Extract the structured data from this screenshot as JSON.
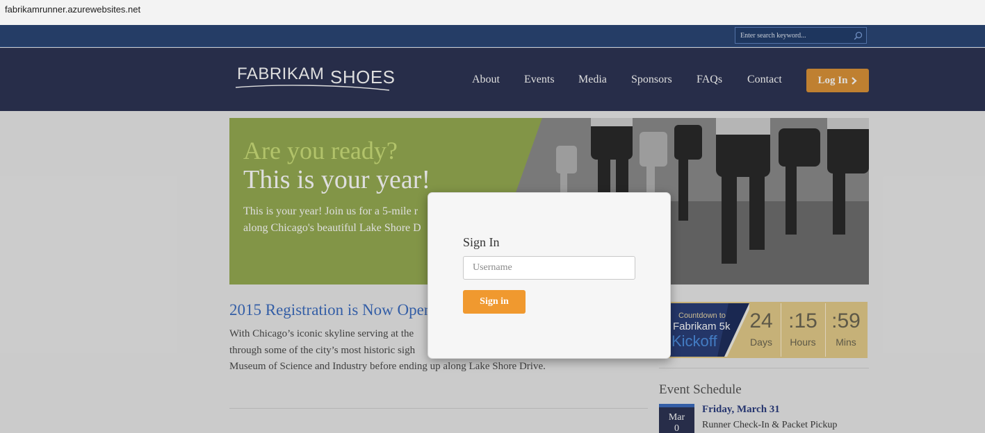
{
  "browser": {
    "url": "fabrikamrunner.azurewebsites.net"
  },
  "topbar": {
    "search_placeholder": "Enter search keyword..."
  },
  "header": {
    "logo_word_1": "FABRIKAM",
    "logo_word_2": "SHOES",
    "nav": [
      "About",
      "Events",
      "Media",
      "Sponsors",
      "FAQs",
      "Contact"
    ],
    "login_label": "Log In"
  },
  "hero": {
    "kicker": "Are you ready?",
    "title": "This is your year!",
    "text_line1": "This is your year! Join us for a 5-mile r",
    "text_line2": "along Chicago's beautiful Lake Shore D"
  },
  "registration": {
    "title": "2015 Registration is Now Open",
    "text_line1": "With Chicago’s iconic skyline serving at the",
    "text_line2": "through some of the city’s most historic sigh",
    "text_line3": "Museum of Science and Industry before ending up along Lake Shore Drive."
  },
  "countdown": {
    "banner_line1": "Countdown to",
    "banner_line2": "Fabrikam 5k",
    "banner_line3": "Kickoff",
    "days_value": "24",
    "days_label": "Days",
    "hours_value": ":15",
    "hours_label": "Hours",
    "mins_value": ":59",
    "mins_label": "Mins"
  },
  "schedule": {
    "title": "Event Schedule",
    "events": [
      {
        "month": "Mar",
        "day": "0",
        "date": "Friday, March 31",
        "name": "Runner Check-In & Packet Pickup"
      }
    ]
  },
  "modal": {
    "title": "Sign In",
    "username_placeholder": "Username",
    "submit_label": "Sign in"
  },
  "colors": {
    "header_bg": "#2d3454",
    "top_strip": "#2b4776",
    "accent_orange": "#dc9439",
    "hero_green": "#96ac52",
    "link_blue": "#3c6dbf"
  }
}
